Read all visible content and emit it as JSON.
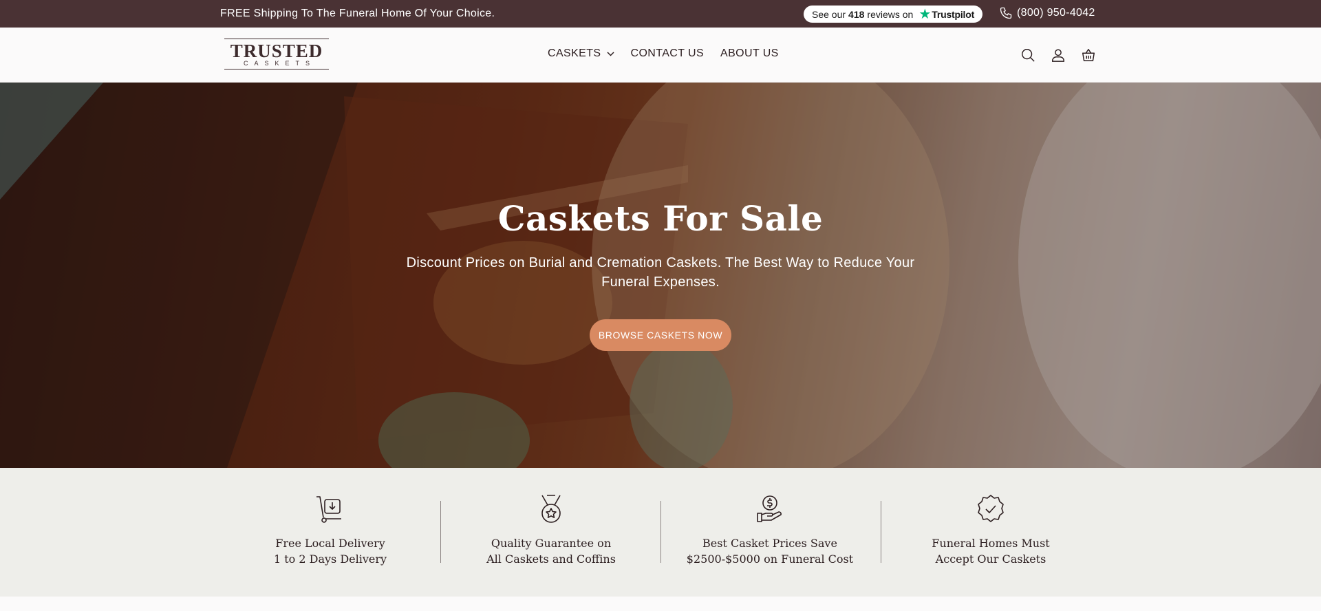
{
  "announcement": {
    "shipping_text": "FREE Shipping To The Funeral Home Of Your Choice.",
    "trustpilot": {
      "prefix": "See our",
      "count": "418",
      "suffix": "reviews on",
      "brand": "Trustpilot",
      "star_color": "#00b67a"
    },
    "phone": "(800) 950-4042"
  },
  "header": {
    "logo": {
      "main": "TRUSTED",
      "sub": "CASKETS"
    },
    "nav": [
      {
        "label": "CASKETS",
        "has_dropdown": true
      },
      {
        "label": "CONTACT US"
      },
      {
        "label": "ABOUT US"
      }
    ],
    "icons": [
      "search-icon",
      "account-icon",
      "cart-icon"
    ]
  },
  "hero": {
    "title": "Caskets For Sale",
    "description": "Discount Prices on Burial and Cremation Caskets. The Best Way to Reduce Your Funeral Expenses.",
    "cta_label": "BROWSE CASKETS NOW",
    "cta_color": "#d98a62"
  },
  "features": [
    {
      "icon": "delivery-cart-icon",
      "line1": "Free Local Delivery",
      "line2": "1 to 2 Days Delivery"
    },
    {
      "icon": "medal-icon",
      "line1": "Quality Guarantee on",
      "line2": "All Caskets and Coffins"
    },
    {
      "icon": "price-hand-icon",
      "line1": "Best Casket Prices Save",
      "line2": "$2500-$5000 on Funeral Cost"
    },
    {
      "icon": "check-badge-icon",
      "line1": "Funeral Homes Must",
      "line2": "Accept Our Caskets"
    }
  ],
  "colors": {
    "topbar": "#4a3234",
    "features_bg": "#eeeeea"
  }
}
